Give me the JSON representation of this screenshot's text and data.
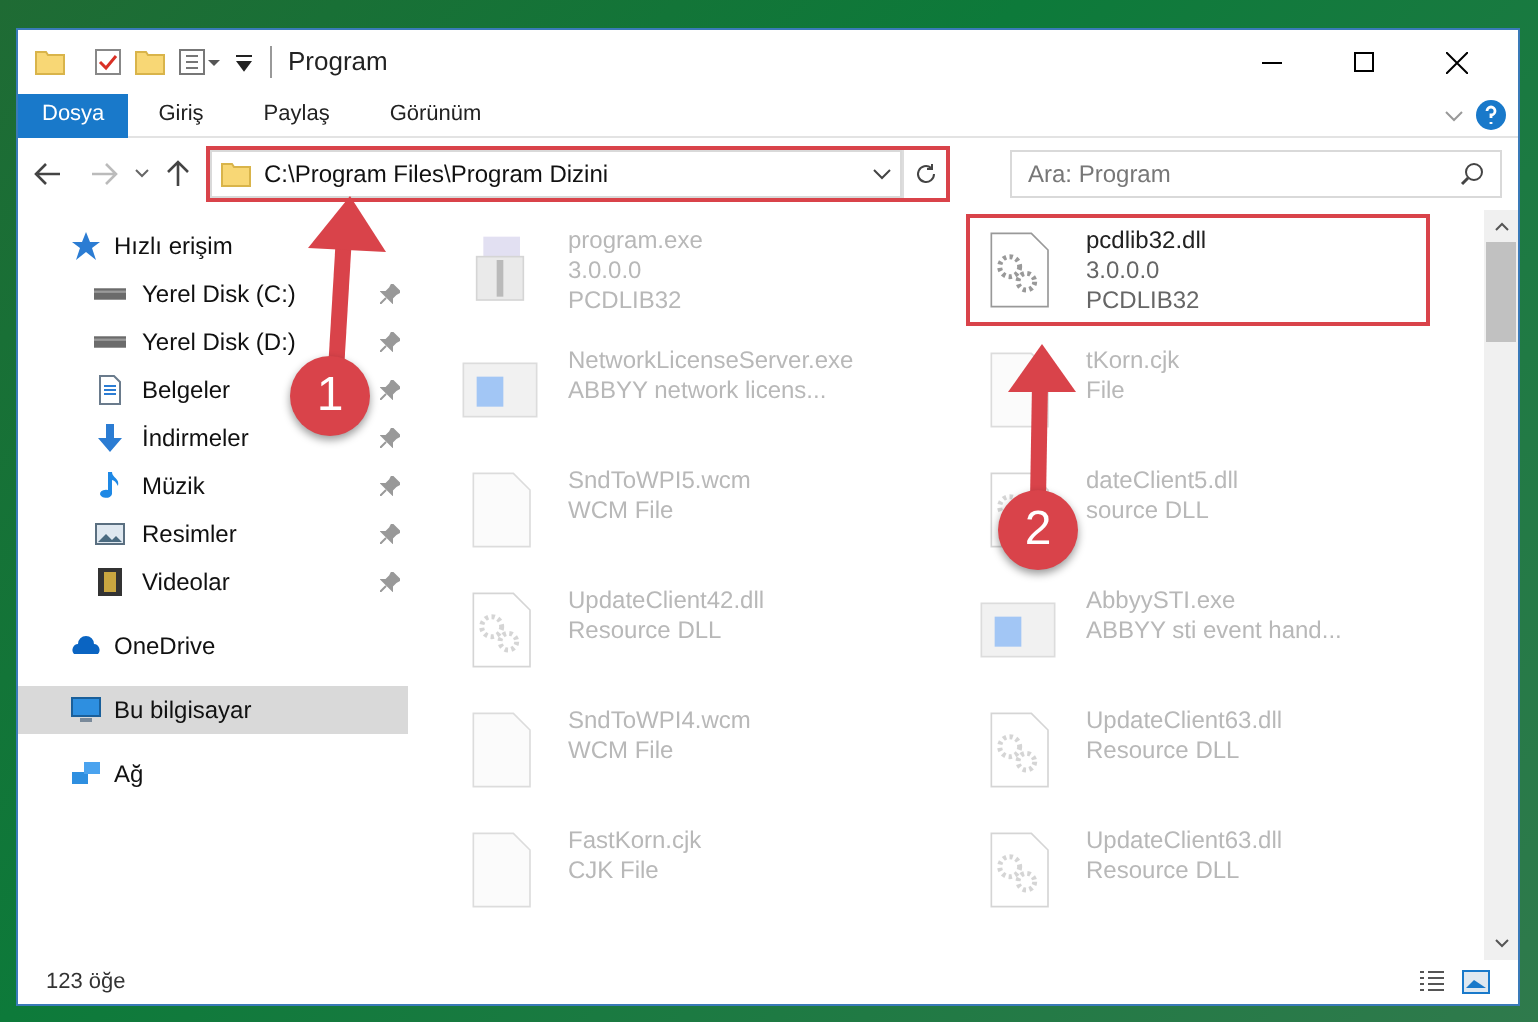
{
  "window": {
    "title": "Program"
  },
  "ribbon_tabs": [
    {
      "label": "Dosya",
      "selected": true
    },
    {
      "label": "Giriş",
      "selected": false
    },
    {
      "label": "Paylaş",
      "selected": false
    },
    {
      "label": "Görünüm",
      "selected": false
    }
  ],
  "address": {
    "path": "C:\\Program Files\\Program Dizini",
    "framed": true
  },
  "search": {
    "placeholder": "Ara: Program"
  },
  "sidebar": {
    "items": [
      {
        "label": "Hızlı erişim",
        "selected": false,
        "children": [
          {
            "label": "Yerel Disk (C:)",
            "pinned": true
          },
          {
            "label": "Yerel Disk (D:)",
            "pinned": true
          },
          {
            "label": "Belgeler",
            "pinned": true
          },
          {
            "label": "İndirmeler",
            "pinned": true
          },
          {
            "label": "Müzik",
            "pinned": true
          },
          {
            "label": "Resimler",
            "pinned": true
          },
          {
            "label": "Videolar",
            "pinned": true
          }
        ]
      },
      {
        "label": "OneDrive",
        "selected": false
      },
      {
        "label": "Bu bilgisayar",
        "selected": true
      },
      {
        "label": "Ağ",
        "selected": false
      }
    ]
  },
  "files": [
    {
      "kind": "installer",
      "blurred": true,
      "framed": false,
      "name": "program.exe",
      "details": [
        "3.0.0.0",
        "PCDLIB32"
      ]
    },
    {
      "kind": "dll",
      "blurred": false,
      "framed": true,
      "name": "pcdlib32.dll",
      "details": [
        "3.0.0.0",
        "PCDLIB32"
      ]
    },
    {
      "kind": "app",
      "blurred": true,
      "framed": false,
      "name": "NetworkLicenseServer.exe",
      "details": [
        "ABBYY network licens..."
      ]
    },
    {
      "kind": "blank",
      "blurred": true,
      "framed": false,
      "name": "tKorn.cjk",
      "details": [
        "File"
      ]
    },
    {
      "kind": "blank",
      "blurred": true,
      "framed": false,
      "name": "SndToWPI5.wcm",
      "details": [
        "WCM File"
      ]
    },
    {
      "kind": "dll",
      "blurred": true,
      "framed": false,
      "name": "dateClient5.dll",
      "details": [
        "source DLL"
      ]
    },
    {
      "kind": "dll",
      "blurred": true,
      "framed": false,
      "name": "UpdateClient42.dll",
      "details": [
        "Resource DLL"
      ]
    },
    {
      "kind": "app",
      "blurred": true,
      "framed": false,
      "name": "AbbyySTI.exe",
      "details": [
        "ABBYY sti event hand..."
      ]
    },
    {
      "kind": "blank",
      "blurred": true,
      "framed": false,
      "name": "SndToWPI4.wcm",
      "details": [
        "WCM File"
      ]
    },
    {
      "kind": "dll",
      "blurred": true,
      "framed": false,
      "name": "UpdateClient63.dll",
      "details": [
        "Resource DLL"
      ]
    },
    {
      "kind": "blank",
      "blurred": true,
      "framed": false,
      "name": "FastKorn.cjk",
      "details": [
        "CJK File"
      ]
    },
    {
      "kind": "dll",
      "blurred": true,
      "framed": false,
      "name": "UpdateClient63.dll",
      "details": [
        "Resource DLL"
      ]
    }
  ],
  "status_bar": {
    "count": "123 öğe"
  },
  "annotations": [
    {
      "number": "1"
    },
    {
      "number": "2"
    }
  ]
}
